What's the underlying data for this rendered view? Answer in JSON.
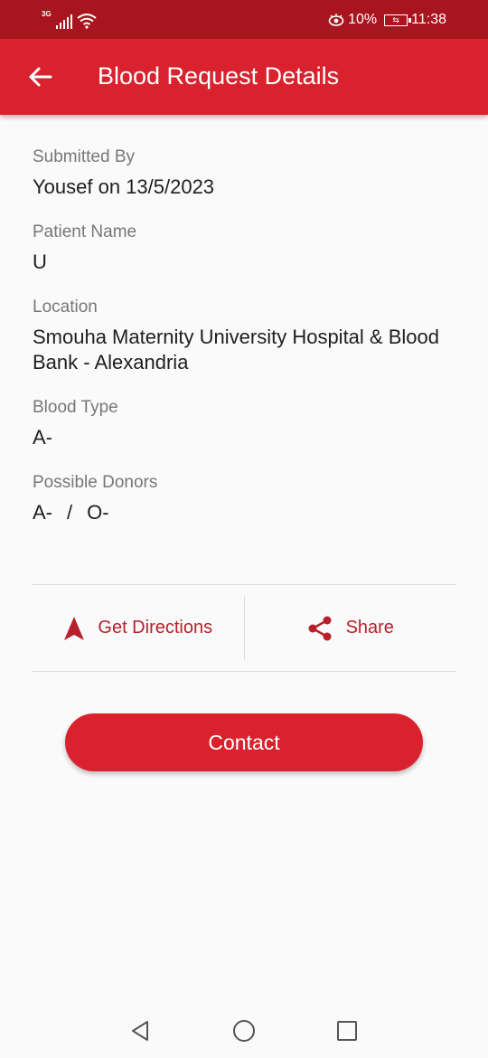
{
  "status_bar": {
    "network": "3G",
    "battery_percent": "10%",
    "time": "11:38",
    "icons": [
      "signal-icon",
      "wifi-icon",
      "eye-icon",
      "battery-icon"
    ]
  },
  "app_bar": {
    "title": "Blood Request Details",
    "back_icon": "arrow-left-icon",
    "color": "#d9222e"
  },
  "details": {
    "submitted_by": {
      "label": "Submitted By",
      "value": "Yousef on 13/5/2023"
    },
    "patient_name": {
      "label": "Patient Name",
      "value": "U"
    },
    "location": {
      "label": "Location",
      "value": "Smouha Maternity University Hospital & Blood Bank - Alexandria"
    },
    "blood_type": {
      "label": "Blood Type",
      "value": "A-"
    },
    "possible_donors": {
      "label": "Possible Donors",
      "values": [
        "A-",
        "O-"
      ],
      "separator": "/"
    }
  },
  "actions": {
    "directions": {
      "label": "Get Directions",
      "icon": "navigation-arrow-icon"
    },
    "share": {
      "label": "Share",
      "icon": "share-icon"
    },
    "accent_color": "#b8202b"
  },
  "contact_button": {
    "label": "Contact"
  },
  "nav_bar": {
    "icons": [
      "back-triangle-icon",
      "home-circle-icon",
      "recents-square-icon"
    ]
  }
}
